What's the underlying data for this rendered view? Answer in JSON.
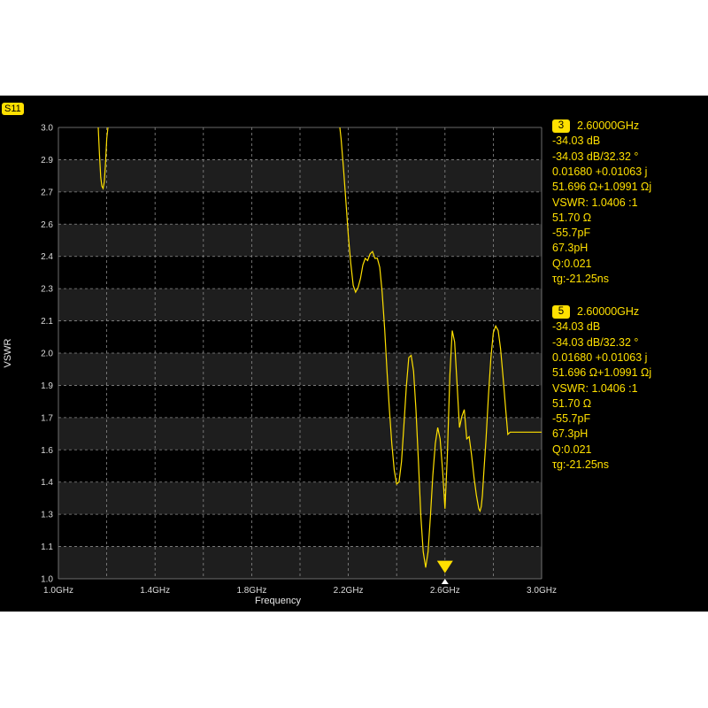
{
  "trace_label": "S11",
  "colors": {
    "trace": "#ffe000",
    "background": "#000000",
    "band": "#1e1e1e",
    "grid": "#8a8a8a"
  },
  "markers": [
    {
      "id": "3",
      "frequency": "2.60000GHz",
      "lines": [
        "-34.03 dB",
        "-34.03 dB/32.32 °",
        "0.01680 +0.01063 j",
        "51.696 Ω+1.0991 Ωj",
        "VSWR: 1.0406 :1",
        "51.70 Ω",
        "-55.7pF",
        "67.3pH",
        "Q:0.021",
        "τg:-21.25ns"
      ]
    },
    {
      "id": "5",
      "frequency": "2.60000GHz",
      "lines": [
        "-34.03 dB",
        "-34.03 dB/32.32 °",
        "0.01680 +0.01063 j",
        "51.696 Ω+1.0991 Ωj",
        "VSWR: 1.0406 :1",
        "51.70 Ω",
        "-55.7pF",
        "67.3pH",
        "Q:0.021",
        "τg:-21.25ns"
      ]
    }
  ],
  "chart_data": {
    "type": "line",
    "xlabel": "Frequency",
    "ylabel": "VSWR",
    "xlim": [
      1.0,
      3.0
    ],
    "ylim": [
      1.0,
      3.0
    ],
    "x_unit": "GHz",
    "x_ticks": [
      "1.0GHz",
      "1.4GHz",
      "1.8GHz",
      "2.2GHz",
      "2.6GHz",
      "3.0GHz"
    ],
    "x_tick_values": [
      1.0,
      1.4,
      1.8,
      2.2,
      2.6,
      3.0
    ],
    "y_ticks": [
      "3.0",
      "2.9",
      "2.7",
      "2.6",
      "2.4",
      "2.3",
      "2.1",
      "2.0",
      "1.9",
      "1.7",
      "1.6",
      "1.4",
      "1.3",
      "1.1",
      "1.0"
    ],
    "y_tick_values": [
      3.0,
      2.9,
      2.7,
      2.6,
      2.4,
      2.3,
      2.1,
      2.0,
      1.9,
      1.7,
      1.6,
      1.4,
      1.3,
      1.1,
      1.0
    ],
    "grid": true,
    "series": [
      {
        "x": [
          1.165,
          1.17,
          1.175,
          1.18,
          1.185,
          1.19,
          1.195,
          1.2,
          1.205,
          1.21,
          1.215,
          1.22,
          1.225,
          1.23,
          2.165,
          2.17,
          2.18,
          2.19,
          2.2,
          2.21,
          2.22,
          2.23,
          2.24,
          2.25,
          2.26,
          2.27,
          2.28,
          2.29,
          2.3,
          2.31,
          2.32,
          2.33,
          2.34,
          2.35,
          2.36,
          2.37,
          2.38,
          2.39,
          2.4,
          2.41,
          2.42,
          2.43,
          2.44,
          2.45,
          2.46,
          2.47,
          2.48,
          2.49,
          2.5,
          2.51,
          2.52,
          2.53,
          2.54,
          2.55,
          2.56,
          2.57,
          2.58,
          2.59,
          2.6,
          2.61,
          2.62,
          2.63,
          2.64,
          2.65,
          2.66,
          2.67,
          2.68,
          2.69,
          2.7,
          2.71,
          2.72,
          2.73,
          2.74,
          2.745,
          2.75,
          2.755,
          2.76,
          2.77,
          2.78,
          2.79,
          2.8,
          2.81,
          2.82,
          2.83,
          2.84,
          2.85,
          2.86,
          2.87,
          2.88,
          2.89,
          2.9,
          2.91,
          2.92,
          2.93,
          2.94,
          2.95,
          2.96,
          2.97,
          2.98,
          2.99,
          3.0
        ],
        "y": [
          3.0,
          2.88,
          2.78,
          2.74,
          2.73,
          2.76,
          2.84,
          2.95,
          3.0,
          null,
          null,
          null,
          null,
          null,
          3.0,
          2.95,
          2.82,
          2.67,
          2.52,
          2.4,
          2.3,
          2.27,
          2.29,
          2.33,
          2.39,
          2.42,
          2.41,
          2.44,
          2.45,
          2.42,
          2.42,
          2.38,
          2.27,
          2.11,
          1.92,
          1.75,
          1.6,
          1.48,
          1.42,
          1.43,
          1.52,
          1.68,
          1.85,
          1.98,
          1.99,
          1.92,
          1.75,
          1.52,
          1.28,
          1.12,
          1.05,
          1.12,
          1.28,
          1.46,
          1.6,
          1.67,
          1.62,
          1.48,
          1.31,
          1.55,
          1.9,
          2.1,
          2.05,
          1.86,
          1.67,
          1.72,
          1.75,
          1.62,
          1.63,
          1.55,
          1.45,
          1.37,
          1.31,
          1.3,
          1.32,
          1.37,
          1.46,
          1.62,
          1.81,
          1.98,
          2.09,
          2.12,
          2.1,
          2.02,
          1.9,
          1.77,
          1.64,
          1.65,
          1.65,
          1.65,
          1.65,
          1.65,
          1.65,
          1.65,
          1.65,
          1.65,
          1.65,
          1.65,
          1.65,
          1.65,
          1.65
        ]
      }
    ],
    "marker_frequency_ghz": 2.6,
    "marker_vswr": 1.0406
  }
}
